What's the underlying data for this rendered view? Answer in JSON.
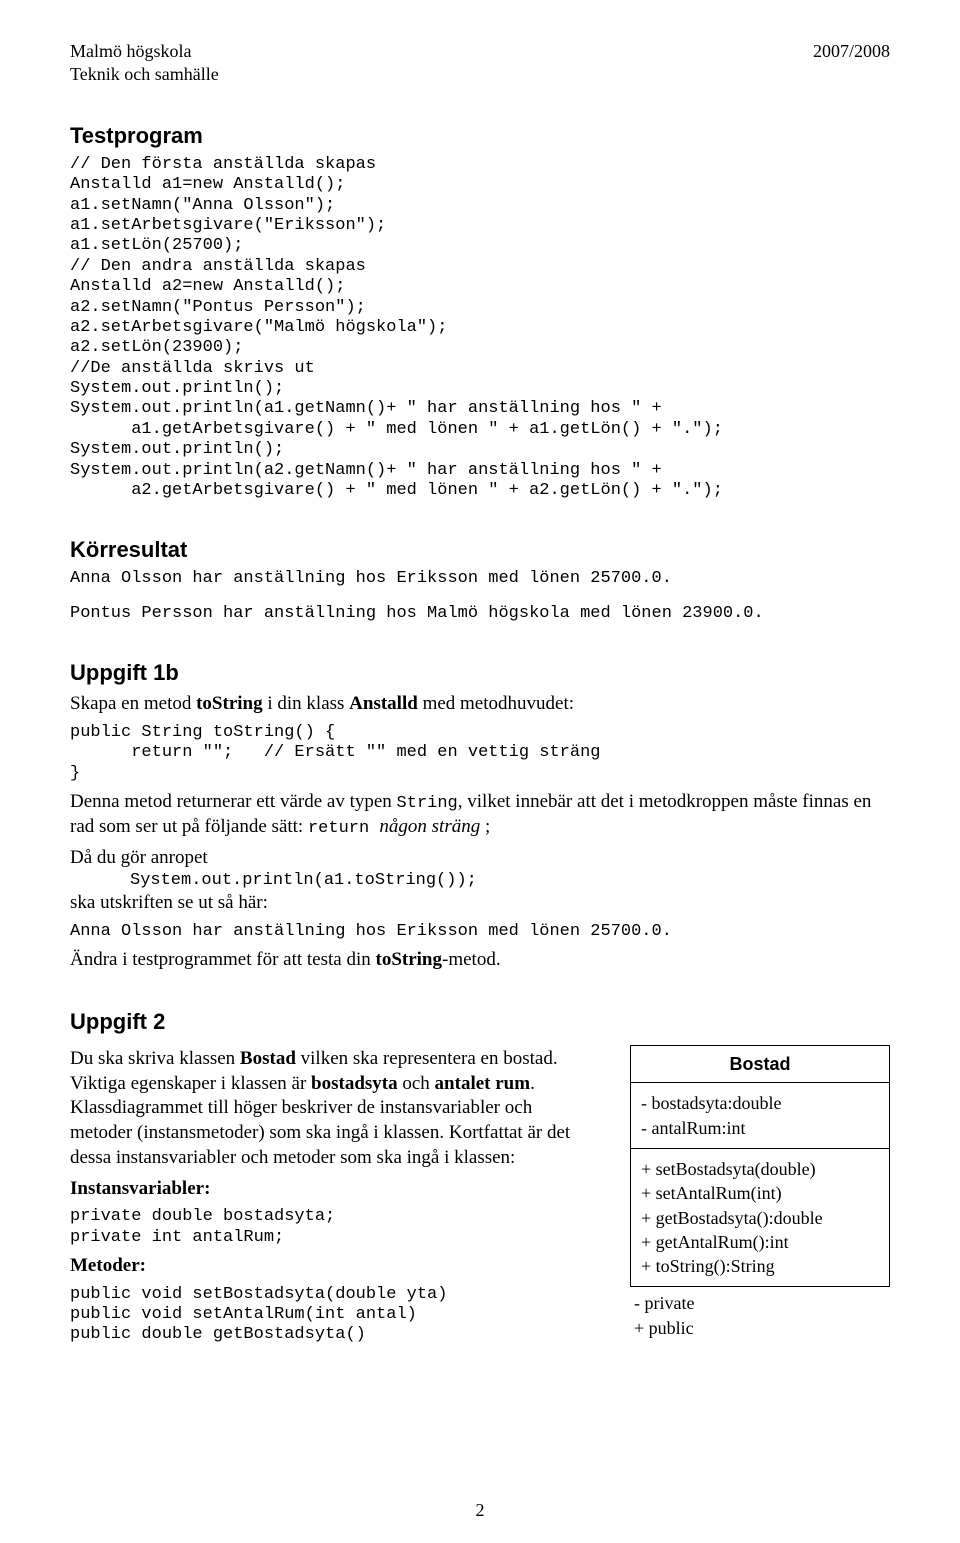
{
  "header": {
    "school": "Malmö högskola",
    "dept": "Teknik och samhälle",
    "year": "2007/2008"
  },
  "section1": {
    "heading": "Testprogram",
    "code": "// Den första anställda skapas\nAnstalld a1=new Anstalld();\na1.setNamn(\"Anna Olsson\");\na1.setArbetsgivare(\"Eriksson\");\na1.setLön(25700);\n// Den andra anställda skapas\nAnstalld a2=new Anstalld();\na2.setNamn(\"Pontus Persson\");\na2.setArbetsgivare(\"Malmö högskola\");\na2.setLön(23900);\n//De anställda skrivs ut\nSystem.out.println();\nSystem.out.println(a1.getNamn()+ \" har anställning hos \" +\n      a1.getArbetsgivare() + \" med lönen \" + a1.getLön() + \".\");\nSystem.out.println();\nSystem.out.println(a2.getNamn()+ \" har anställning hos \" +\n      a2.getArbetsgivare() + \" med lönen \" + a2.getLön() + \".\");"
  },
  "section2": {
    "heading": "Körresultat",
    "line1": "Anna Olsson har anställning hos Eriksson med lönen 25700.0.",
    "line2": "Pontus Persson har anställning hos Malmö högskola med lönen 23900.0."
  },
  "section3": {
    "heading": "Uppgift 1b",
    "intro_pre": "Skapa en metod ",
    "intro_b1": "toString",
    "intro_mid": " i din klass ",
    "intro_b2": "Anstalld",
    "intro_post": " med metodhuvudet:",
    "code": "public String toString() {\n      return \"\";   // Ersätt \"\" med en vettig sträng\n}",
    "p2_pre": "Denna metod returnerar ett värde av typen ",
    "p2_mono1": "String",
    "p2_mid": ", vilket innebär att det i metodkroppen måste finnas en rad som ser ut på följande sätt: ",
    "p2_mono2": "return ",
    "p2_ital": "någon sträng",
    "p2_post": " ;",
    "p3": "Då du gör anropet",
    "p3_code": "System.out.println(a1.toString());",
    "p4": "ska utskriften se ut så här:",
    "p4_out": "Anna Olsson har anställning hos Eriksson med lönen 25700.0.",
    "p5_pre": "Ändra i testprogrammet för att testa din ",
    "p5_b": "toString",
    "p5_post": "-metod."
  },
  "section4": {
    "heading": "Uppgift 2",
    "p1_pre": "Du ska skriva klassen ",
    "p1_b1": "Bostad",
    "p1_mid1": " vilken ska representera en bostad. Viktiga egenskaper i klassen är ",
    "p1_b2": "bostadsyta",
    "p1_mid2": " och ",
    "p1_b3": "antalet rum",
    "p1_post": ". Klassdiagrammet till höger beskriver de instansvariabler och metoder (instansmetoder) som ska ingå i klassen. Kortfattat är det dessa instansvariabler och metoder som ska ingå i klassen:",
    "h_iv": "Instansvariabler:",
    "code_iv": "private double bostadsyta;\nprivate int antalRum;",
    "h_m": "Metoder:",
    "code_m": "public void setBostadsyta(double yta)\npublic void setAntalRum(int antal)\npublic double getBostadsyta()"
  },
  "uml": {
    "title": "Bostad",
    "attrs": "- bostadsyta:double\n- antalRum:int",
    "ops": "+ setBostadsyta(double)\n+ setAntalRum(int)\n+ getBostadsyta():double\n+ getAntalRum():int\n+ toString():String",
    "legend_private": "-  private",
    "legend_public": "+ public"
  },
  "page_number": "2"
}
